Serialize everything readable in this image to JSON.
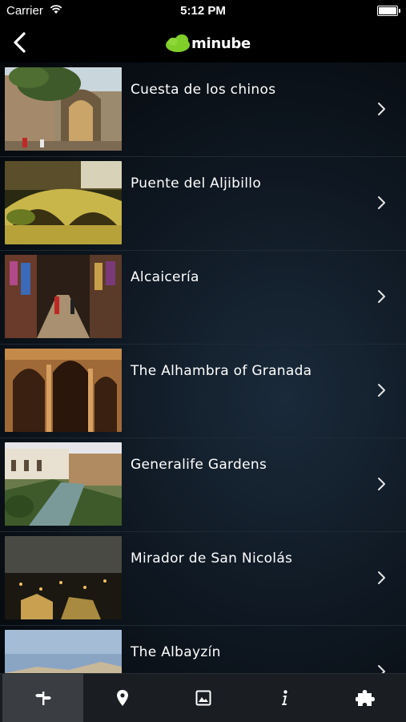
{
  "status": {
    "carrier": "Carrier",
    "time": "5:12 PM"
  },
  "brand": {
    "name": "minube",
    "accent": "#7fce2a"
  },
  "places": [
    {
      "title": "Cuesta de los chinos"
    },
    {
      "title": "Puente del Aljibillo"
    },
    {
      "title": "Alcaicería"
    },
    {
      "title": "The Alhambra of Granada"
    },
    {
      "title": "Generalife Gardens"
    },
    {
      "title": "Mirador de San Nicolás"
    },
    {
      "title": "The Albayzín"
    }
  ],
  "tabs": [
    {
      "icon": "signpost-icon",
      "active": true
    },
    {
      "icon": "map-pin-icon"
    },
    {
      "icon": "photo-icon"
    },
    {
      "icon": "info-icon"
    },
    {
      "icon": "puzzle-icon"
    }
  ]
}
